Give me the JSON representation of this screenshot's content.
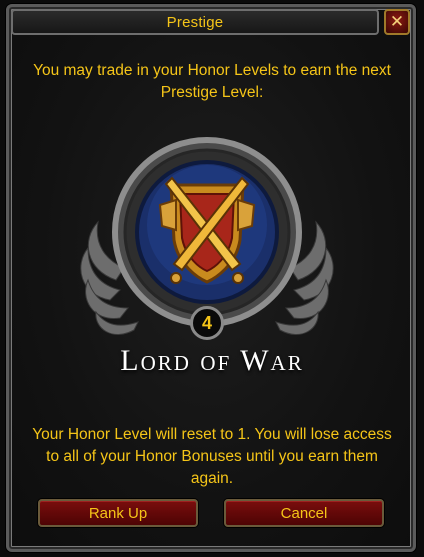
{
  "window": {
    "title": "Prestige",
    "close_glyph": "✕"
  },
  "intro_text": "You may trade in your Honor Levels to earn the next Prestige Level:",
  "prestige": {
    "level": "4",
    "name": "Lord of War",
    "emblem_icon": "crossed-swords-shield-icon"
  },
  "warning_text": "Your Honor Level will reset to 1. You will lose access to all of your Honor Bonuses until you earn them again.",
  "buttons": {
    "rank_up": "Rank Up",
    "cancel": "Cancel"
  },
  "colors": {
    "gold_text": "#f5c518",
    "button_red": "#7a0d0d",
    "emblem_blue": "#1a2f6a"
  }
}
